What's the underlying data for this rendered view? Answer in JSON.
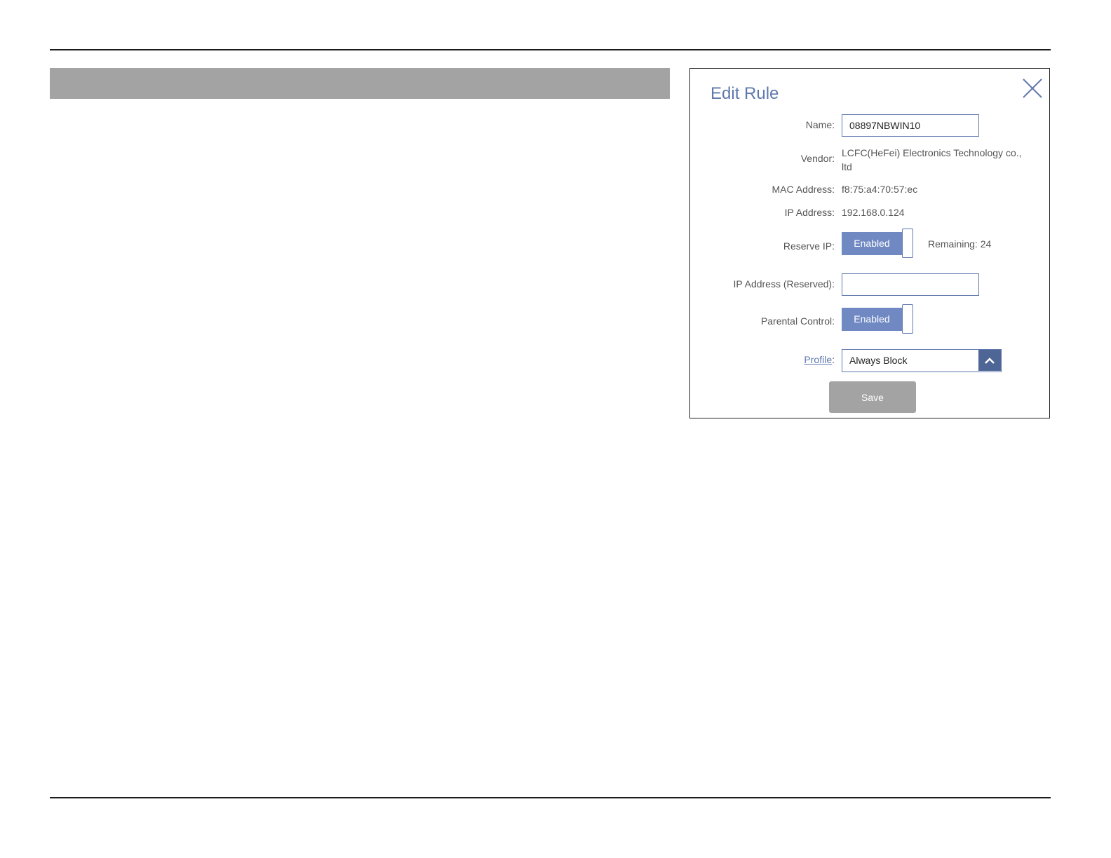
{
  "dialog": {
    "title": "Edit Rule",
    "close_icon": "close-icon"
  },
  "fields": {
    "name_label": "Name:",
    "name_value": "08897NBWIN10",
    "vendor_label": "Vendor:",
    "vendor_line1": "LCFC(HeFei) Electronics Technology co.,",
    "vendor_line2": "ltd",
    "mac_label": "MAC Address:",
    "mac_value": "f8:75:a4:70:57:ec",
    "ip_label": "IP Address:",
    "ip_value": "192.168.0.124",
    "reserve_ip_label": "Reserve IP:",
    "reserve_ip_state": "Enabled",
    "remaining_text": "Remaining: 24",
    "ip_reserved_label": "IP Address (Reserved):",
    "ip_reserved_value": "",
    "parental_label": "Parental Control:",
    "parental_state": "Enabled",
    "profile_label": "Profile",
    "profile_colon": ":",
    "profile_value": "Always Block",
    "profile_arrow_icon": "chevron-up-icon"
  },
  "actions": {
    "save_label": "Save"
  },
  "colors": {
    "accent": "#5f78ad",
    "toggle_on": "#7089c3",
    "select_arrow_bg": "#4e6696",
    "save_bg": "#a3a3a3",
    "header_bar": "#a3a3a3"
  }
}
